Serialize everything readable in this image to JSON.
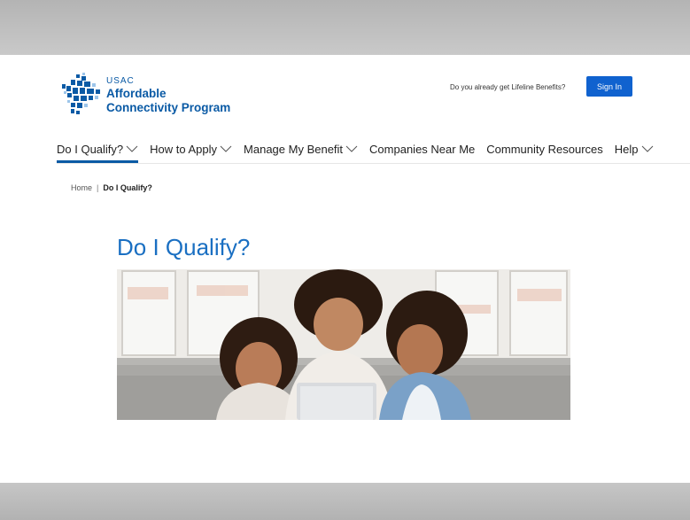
{
  "header": {
    "logo": {
      "org": "USAC",
      "line1": "Affordable",
      "line2": "Connectivity Program",
      "color": "#0a5aa5"
    },
    "lifeline_prompt": "Do you already get Lifeline Benefits?",
    "sign_in_label": "Sign In",
    "sign_in_color": "#1062cf"
  },
  "nav": {
    "items": [
      {
        "label": "Do I Qualify?",
        "has_dropdown": true,
        "active": true
      },
      {
        "label": "How to Apply",
        "has_dropdown": true
      },
      {
        "label": "Manage My Benefit",
        "has_dropdown": true
      },
      {
        "label": "Companies Near Me",
        "has_dropdown": false
      },
      {
        "label": "Community Resources",
        "has_dropdown": false
      },
      {
        "label": "Help",
        "has_dropdown": true
      }
    ],
    "chevron_icon": "chevron-down-icon"
  },
  "breadcrumb": {
    "home": "Home",
    "separator": "|",
    "current": "Do I Qualify?"
  },
  "main": {
    "title": "Do I Qualify?",
    "title_color": "#1a6fc2"
  }
}
